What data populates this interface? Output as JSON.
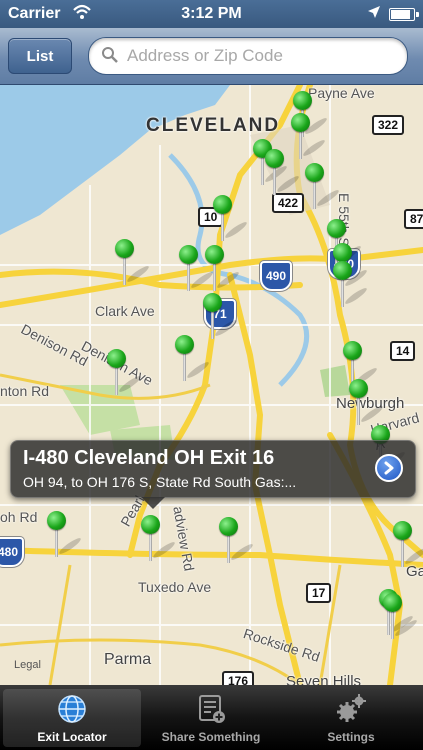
{
  "status_bar": {
    "carrier": "Carrier",
    "time": "3:12 PM",
    "icons": [
      "wifi-icon",
      "location-arrow-icon",
      "battery-icon"
    ]
  },
  "nav": {
    "list_label": "List",
    "search_placeholder": "Address or Zip Code",
    "search_value": ""
  },
  "map": {
    "city": "CLEVELAND",
    "labels": {
      "payne": "Payne Ave",
      "clark": "Clark Ave",
      "denison": "Denison Ave",
      "denison_rd": "Denison Rd",
      "newburgh": "Newburgh",
      "harvard": "Harvard A",
      "tuxedo": "Tuxedo Ave",
      "rockside": "Rockside Rd",
      "parma": "Parma",
      "seven_hills": "Seven Hills",
      "e55": "E 55th St",
      "pearl": "Pearl",
      "broadview": "adview Rd",
      "ohrd": "oh Rd",
      "ntonrd": "nton Rd",
      "ga": "Ga",
      "legal": "Legal"
    },
    "shields": {
      "s322": "322",
      "s422": "422",
      "s10": "10",
      "s87": "87",
      "s490": "490",
      "s490b": "490",
      "s71": "71",
      "s14": "14",
      "s480": "480",
      "s17": "17",
      "s176": "176"
    }
  },
  "callout": {
    "title": "I-480 Cleveland OH Exit 16",
    "subtitle": "OH 94, to OH 176 S, State Rd  South Gas:..."
  },
  "tabs": [
    {
      "label": "Exit Locator",
      "icon": "globe-icon",
      "active": true
    },
    {
      "label": "Share Something",
      "icon": "share-compose-icon",
      "active": false
    },
    {
      "label": "Settings",
      "icon": "gears-icon",
      "active": false
    }
  ],
  "colors": {
    "nav_blue": "#5f7da4",
    "pin_green": "#1aa61a",
    "water": "#9ccae8",
    "road_yellow": "#f7d33c",
    "callout_bg": "#282828",
    "disclosure_blue": "#1e56c4"
  }
}
